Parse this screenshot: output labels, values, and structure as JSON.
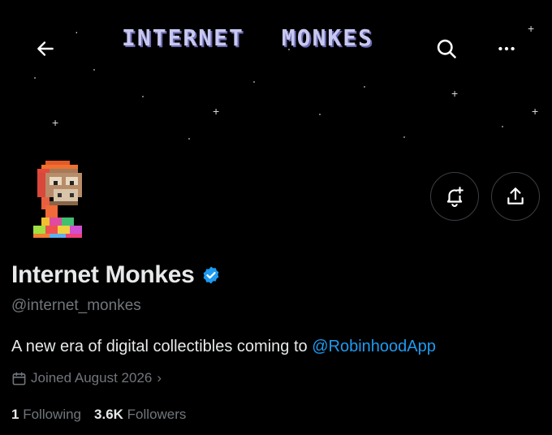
{
  "banner": {
    "title_word1": "INTERNET",
    "title_word2": "MONKES"
  },
  "nav": {
    "back_icon": "arrow-left-icon",
    "search_icon": "search-icon",
    "more_icon": "more-dots-icon"
  },
  "profile": {
    "name": "Internet Monkes",
    "verified": true,
    "handle": "@internet_monkes",
    "bio_text": "A new era of digital collectibles coming to ",
    "bio_mention": "@RobinhoodApp",
    "joined": "Joined August 2026",
    "following_count": "1",
    "following_label": "Following",
    "followers_count": "3.6K",
    "followers_label": "Followers"
  },
  "actions": {
    "notify_icon": "bell-plus-icon",
    "share_icon": "share-icon"
  },
  "colors": {
    "background": "#000000",
    "text_primary": "#e7e9ea",
    "text_secondary": "#71767b",
    "link": "#1d9bf0",
    "verified": "#1d9bf0"
  }
}
